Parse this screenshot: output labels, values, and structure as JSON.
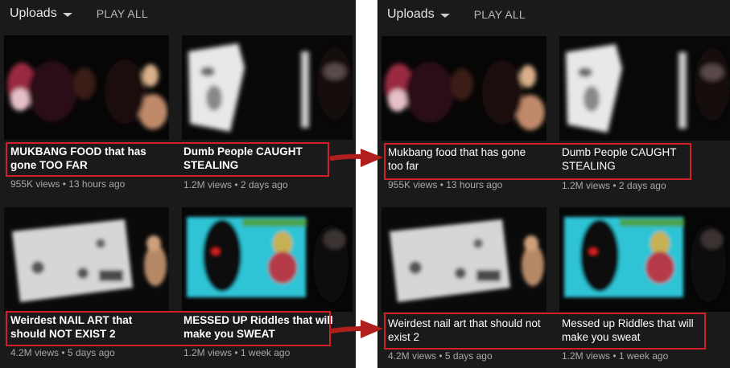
{
  "before": {
    "header": {
      "uploads_label": "Uploads",
      "play_all_label": "PLAY ALL"
    },
    "videos": [
      {
        "title": "MUKBANG FOOD that has gone TOO FAR",
        "views": "955K views",
        "age": "13 hours ago"
      },
      {
        "title": "Dumb People CAUGHT STEALING",
        "views": "1.2M views",
        "age": "2 days ago"
      },
      {
        "title": "Weirdest NAIL ART that should NOT EXIST 2",
        "views": "4.2M views",
        "age": "5 days ago"
      },
      {
        "title": "MESSED UP Riddles that will make you SWEAT",
        "views": "1.2M views",
        "age": "1 week ago"
      }
    ]
  },
  "after": {
    "header": {
      "uploads_label": "Uploads",
      "play_all_label": "PLAY ALL"
    },
    "videos": [
      {
        "title": "Mukbang food that has gone too far",
        "views": "955K views",
        "age": "13 hours ago"
      },
      {
        "title": "Dumb People CAUGHT STEALING",
        "views": "1.2M views",
        "age": "2 days ago"
      },
      {
        "title": "Weirdest nail art that should not exist 2",
        "views": "4.2M views",
        "age": "5 days ago"
      },
      {
        "title": "Messed up Riddles that will make you sweat",
        "views": "1.2M views",
        "age": "1 week ago"
      }
    ]
  },
  "meta_separator": " • ",
  "colors": {
    "highlight": "#d0202a",
    "arrow": "#b01e1e",
    "panel_bg": "#1a1a1a",
    "accent_cyan": "#2ec4d6"
  }
}
